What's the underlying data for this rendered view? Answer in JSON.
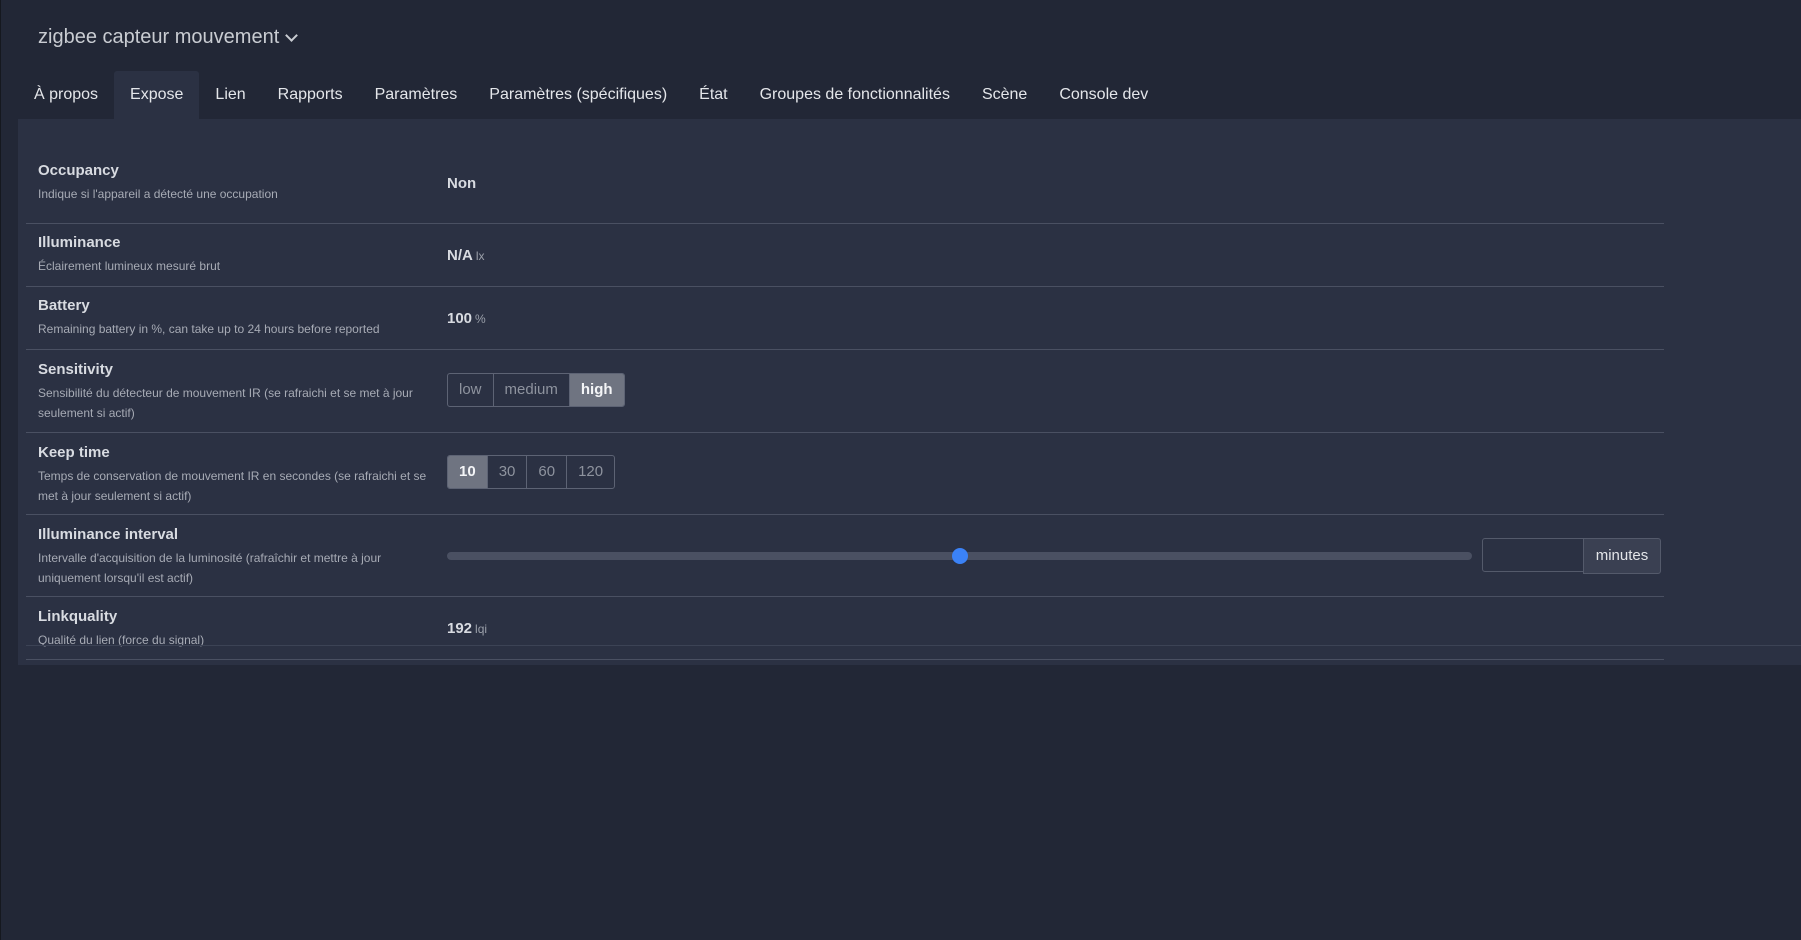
{
  "device": {
    "title": "zigbee capteur mouvement"
  },
  "tabs": [
    {
      "label": "À propos",
      "active": false
    },
    {
      "label": "Expose",
      "active": true
    },
    {
      "label": "Lien",
      "active": false
    },
    {
      "label": "Rapports",
      "active": false
    },
    {
      "label": "Paramètres",
      "active": false
    },
    {
      "label": "Paramètres (spécifiques)",
      "active": false
    },
    {
      "label": "État",
      "active": false
    },
    {
      "label": "Groupes de fonctionnalités",
      "active": false
    },
    {
      "label": "Scène",
      "active": false
    },
    {
      "label": "Console dev",
      "active": false
    }
  ],
  "features": {
    "occupancy": {
      "name": "Occupancy",
      "description": "Indique si l'appareil a détecté une occupation",
      "value": "Non"
    },
    "illuminance": {
      "name": "Illuminance",
      "description": "Éclairement lumineux mesuré brut",
      "value": "N/A",
      "unit": "lx"
    },
    "battery": {
      "name": "Battery",
      "description": "Remaining battery in %, can take up to 24 hours before reported",
      "value": "100",
      "unit": "%"
    },
    "sensitivity": {
      "name": "Sensitivity",
      "description": "Sensibilité du détecteur de mouvement IR (se rafraichi et se met à jour seulement si actif)",
      "options": [
        "low",
        "medium",
        "high"
      ],
      "selected": "high"
    },
    "keep_time": {
      "name": "Keep time",
      "description": "Temps de conservation de mouvement IR en secondes (se rafraichi et se met à jour seulement si actif)",
      "options": [
        "10",
        "30",
        "60",
        "120"
      ],
      "selected": "10"
    },
    "illuminance_interval": {
      "name": "Illuminance interval",
      "description": "Intervalle d'acquisition de la luminosité (rafraîchir et mettre à jour uniquement lorsqu'il est actif)",
      "slider_fraction": 0.5,
      "input_value": "",
      "unit": "minutes"
    },
    "linkquality": {
      "name": "Linkquality",
      "description": "Qualité du lien (force du signal)",
      "value": "192",
      "unit": "lqi"
    }
  },
  "colors": {
    "accent": "#3b82f6",
    "selected_option": "#6f7481"
  }
}
